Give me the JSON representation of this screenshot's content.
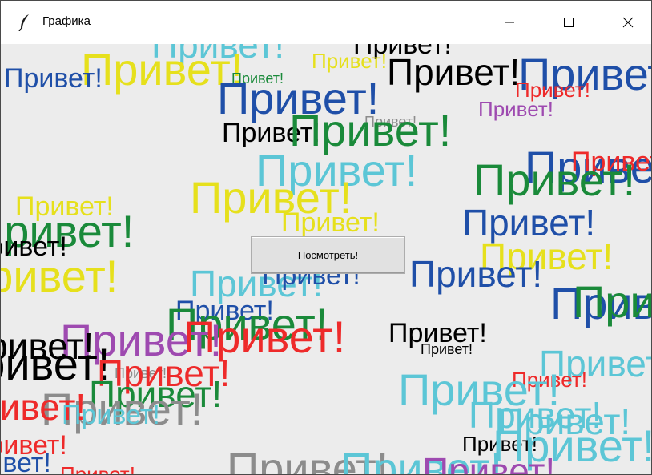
{
  "window": {
    "title": "Графика",
    "icon": "feather-icon",
    "controls": [
      "minimize-icon",
      "maximize-icon",
      "close-icon"
    ]
  },
  "greeting_word": "Привет!",
  "button": {
    "label": "Посмотреть!"
  },
  "colors": {
    "yellow": "#e6e01c",
    "cyan": "#5cc6d6",
    "blue": "#1f4fa8",
    "green": "#1a8a3a",
    "red": "#ee2a2a",
    "purple": "#9e4ab0",
    "gray": "#8c8c8c",
    "black": "#000000"
  }
}
